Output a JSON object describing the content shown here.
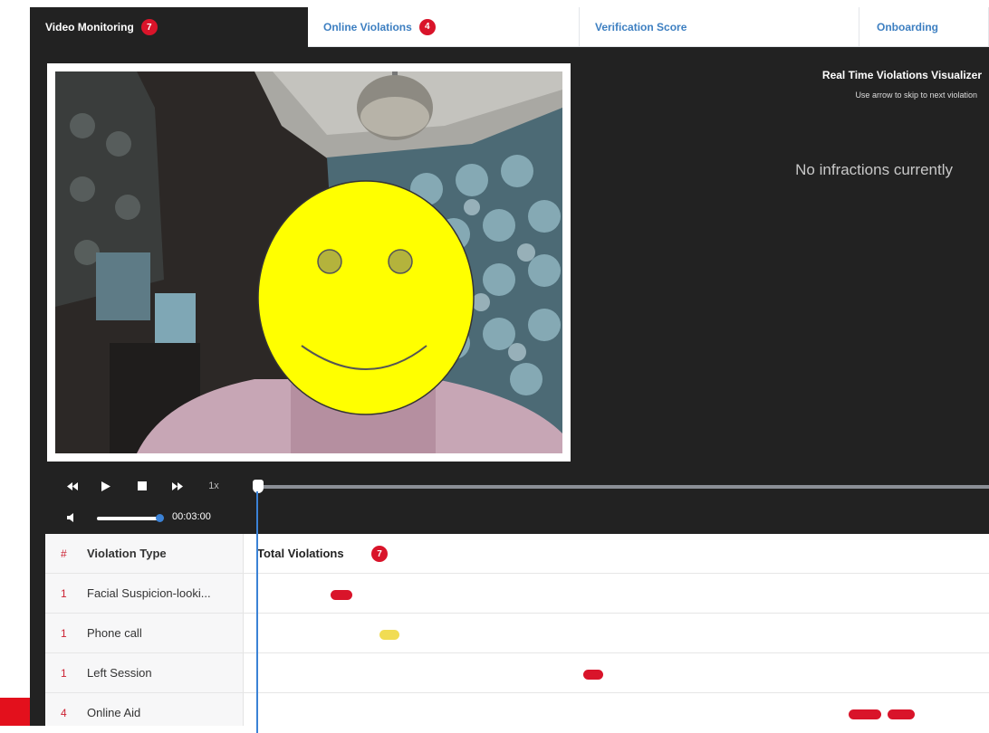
{
  "tabs": [
    {
      "label": "Video Monitoring",
      "badge": "7"
    },
    {
      "label": "Online Violations",
      "badge": "4"
    },
    {
      "label": "Verification Score",
      "badge": ""
    },
    {
      "label": "Onboarding",
      "badge": ""
    }
  ],
  "visualizer": {
    "title": "Real Time Violations Visualizer",
    "subtitle": "Use arrow to skip to next violation",
    "empty_message": "No infractions currently"
  },
  "player": {
    "rewind_icon": "rewind-icon",
    "play_icon": "play-icon",
    "stop_icon": "stop-icon",
    "fast_forward_icon": "fast-forward-icon",
    "speed": "1x",
    "volume_icon": "volume-icon",
    "time": "00:03:00"
  },
  "table": {
    "header": {
      "num": "#",
      "type": "Violation Type",
      "total": "Total Violations",
      "total_badge": "7"
    },
    "rows": [
      {
        "num": "1",
        "type": "Facial Suspicion-looki..."
      },
      {
        "num": "1",
        "type": "Phone call"
      },
      {
        "num": "1",
        "type": "Left Session"
      },
      {
        "num": "4",
        "type": "Online Aid"
      }
    ]
  },
  "colors": {
    "accent": "#3b82d6",
    "violation": "#d9142a",
    "warning": "#f1dc53",
    "dark_panel": "#222222"
  }
}
